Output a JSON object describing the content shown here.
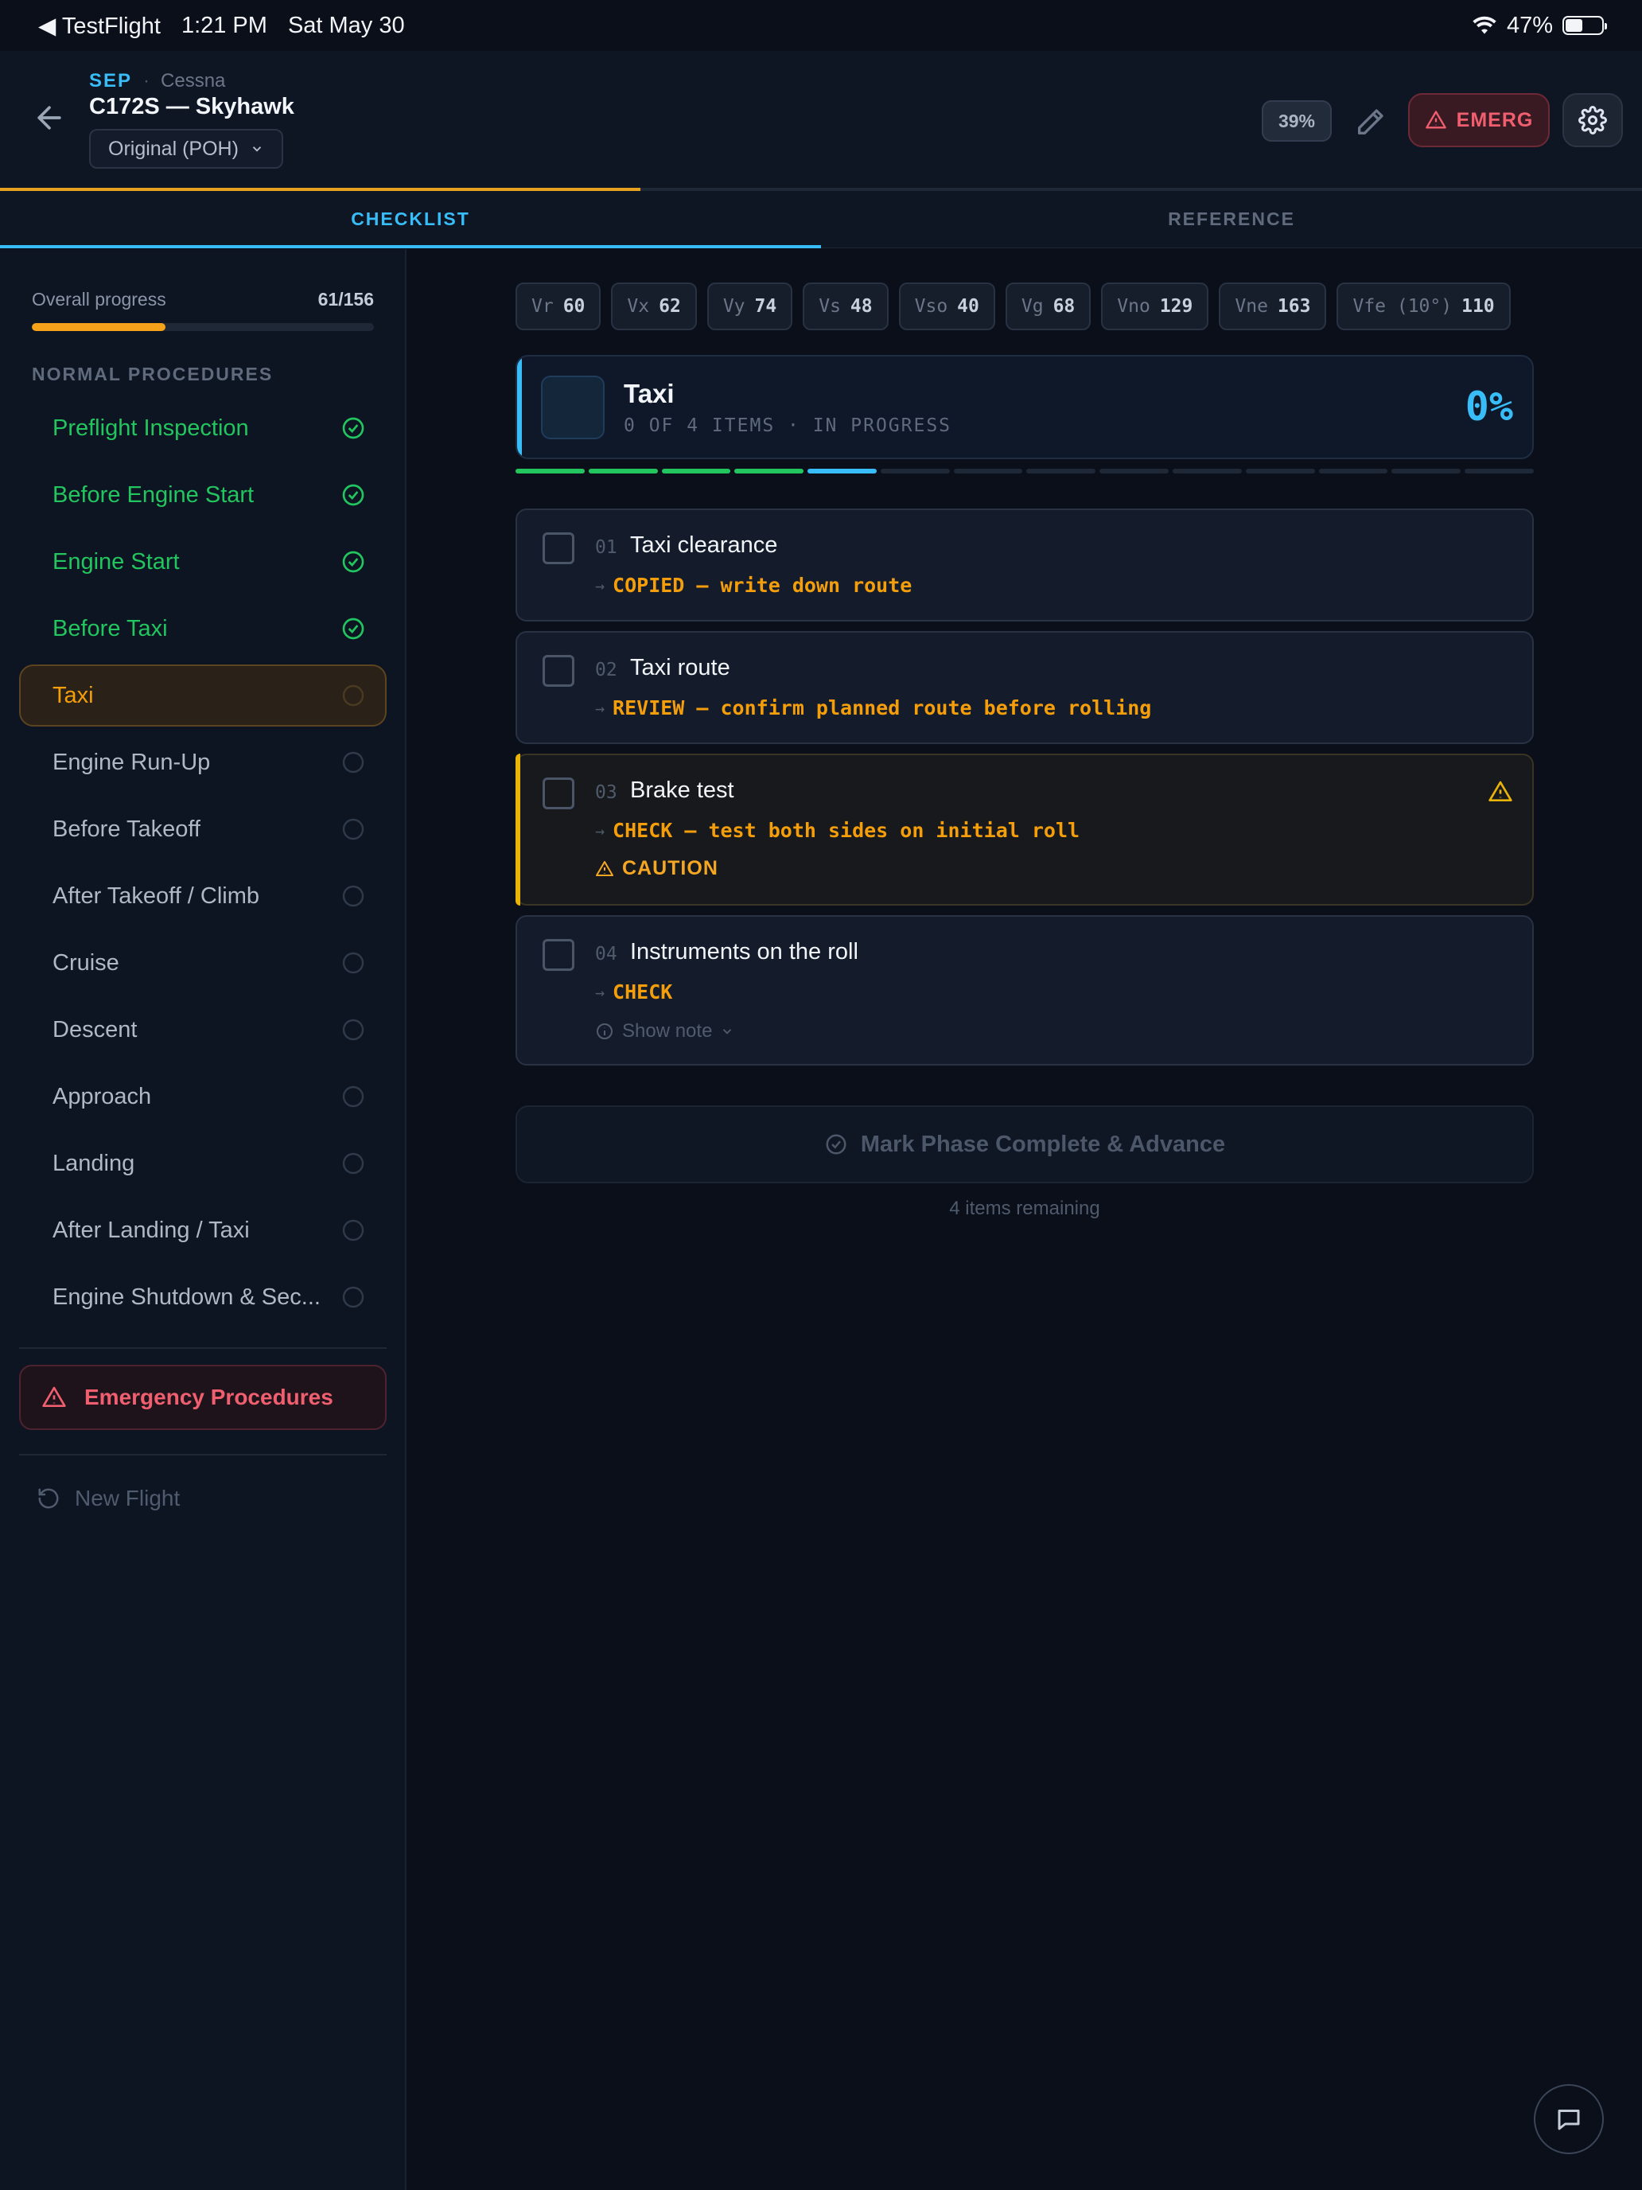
{
  "status_bar": {
    "back_app": "◀ TestFlight",
    "time": "1:21 PM",
    "date": "Sat May 30",
    "battery": "47%",
    "battery_level": 0.47
  },
  "header": {
    "category": "SEP",
    "manufacturer": "Cessna",
    "title": "C172S — Skyhawk",
    "variant": "Original (POH)",
    "progress_pill": "39%",
    "progress_fraction": 0.39,
    "emergency_label": "EMERG"
  },
  "tabs": [
    {
      "label": "CHECKLIST",
      "active": true
    },
    {
      "label": "REFERENCE",
      "active": false
    }
  ],
  "sidebar": {
    "overall_label": "Overall progress",
    "overall_value": "61/156",
    "overall_fraction": 0.391,
    "section_title": "NORMAL PROCEDURES",
    "phases": [
      {
        "name": "Preflight Inspection",
        "state": "done"
      },
      {
        "name": "Before Engine Start",
        "state": "done"
      },
      {
        "name": "Engine Start",
        "state": "done"
      },
      {
        "name": "Before Taxi",
        "state": "done"
      },
      {
        "name": "Taxi",
        "state": "active"
      },
      {
        "name": "Engine Run-Up",
        "state": "pending"
      },
      {
        "name": "Before Takeoff",
        "state": "pending"
      },
      {
        "name": "After Takeoff / Climb",
        "state": "pending"
      },
      {
        "name": "Cruise",
        "state": "pending"
      },
      {
        "name": "Descent",
        "state": "pending"
      },
      {
        "name": "Approach",
        "state": "pending"
      },
      {
        "name": "Landing",
        "state": "pending"
      },
      {
        "name": "After Landing / Taxi",
        "state": "pending"
      },
      {
        "name": "Engine Shutdown & Sec...",
        "state": "pending"
      }
    ],
    "emergency_label": "Emergency Procedures",
    "new_flight_label": "New Flight"
  },
  "vspeeds": [
    {
      "k": "Vr",
      "v": "60"
    },
    {
      "k": "Vx",
      "v": "62"
    },
    {
      "k": "Vy",
      "v": "74"
    },
    {
      "k": "Vs",
      "v": "48"
    },
    {
      "k": "Vso",
      "v": "40"
    },
    {
      "k": "Vg",
      "v": "68"
    },
    {
      "k": "Vno",
      "v": "129"
    },
    {
      "k": "Vne",
      "v": "163"
    },
    {
      "k": "Vfe (10°)",
      "v": "110"
    }
  ],
  "phase_card": {
    "title": "Taxi",
    "subtitle": "0 OF 4 ITEMS · IN PROGRESS",
    "percent": "0%"
  },
  "phase_segments": [
    "done",
    "done",
    "done",
    "done",
    "current",
    "pending",
    "pending",
    "pending",
    "pending",
    "pending",
    "pending",
    "pending",
    "pending",
    "pending"
  ],
  "items": [
    {
      "num": "01",
      "title": "Taxi clearance",
      "action": "COPIED — write down route"
    },
    {
      "num": "02",
      "title": "Taxi route",
      "action": "REVIEW — confirm planned route before rolling"
    },
    {
      "num": "03",
      "title": "Brake test",
      "action": "CHECK — test both sides on initial roll",
      "caution": "CAUTION"
    },
    {
      "num": "04",
      "title": "Instruments on the roll",
      "action": "CHECK",
      "note": "Show note"
    }
  ],
  "advance_label": "Mark Phase Complete & Advance",
  "remaining": "4 items remaining",
  "icons": {
    "back": "arrow-left-icon",
    "pencil": "pencil-icon",
    "alert": "alert-triangle-icon",
    "settings": "gear-icon",
    "check": "check-circle-icon",
    "chat": "chat-bubble-icon",
    "refresh": "rotate-ccw-icon"
  },
  "colors": {
    "accent_blue": "#38bdf8",
    "done_green": "#22c55e",
    "active_orange": "#f59e0b",
    "emergency_red": "#ef5f6f",
    "caution_yellow": "#eab308"
  }
}
